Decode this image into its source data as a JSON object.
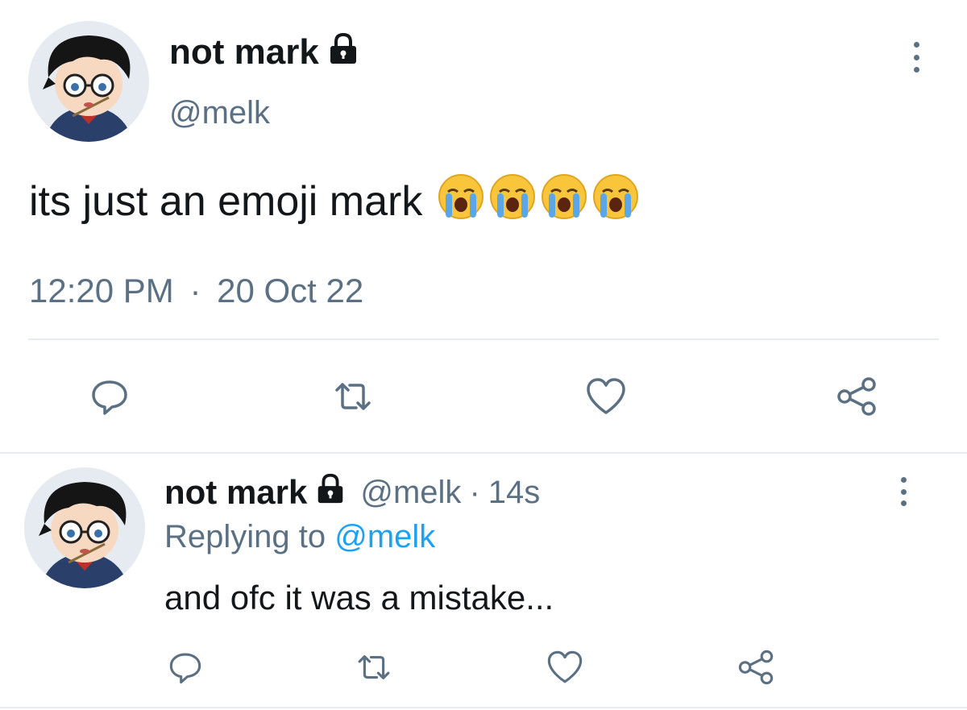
{
  "main_tweet": {
    "display_name": "not mark",
    "handle": "@melk",
    "text": "its just an emoji mark",
    "emoji_icons": [
      "loudly-crying-face-icon",
      "loudly-crying-face-icon",
      "loudly-crying-face-icon",
      "loudly-crying-face-icon"
    ],
    "time": "12:20 PM",
    "separator": "·",
    "date": "20 Oct 22",
    "actions": [
      "reply-icon",
      "retweet-icon",
      "like-icon",
      "share-icon"
    ]
  },
  "reply_tweet": {
    "display_name": "not mark",
    "handle": "@melk",
    "separator": "·",
    "age": "14s",
    "replying_prefix": "Replying to",
    "replying_mention": "@melk",
    "text": "and ofc it was a mistake...",
    "actions": [
      "reply-icon",
      "retweet-icon",
      "like-icon",
      "share-icon"
    ]
  },
  "colors": {
    "text": "#14171a",
    "secondary": "#5b7083",
    "link": "#1da1f2",
    "divider": "#e6ecf0"
  }
}
